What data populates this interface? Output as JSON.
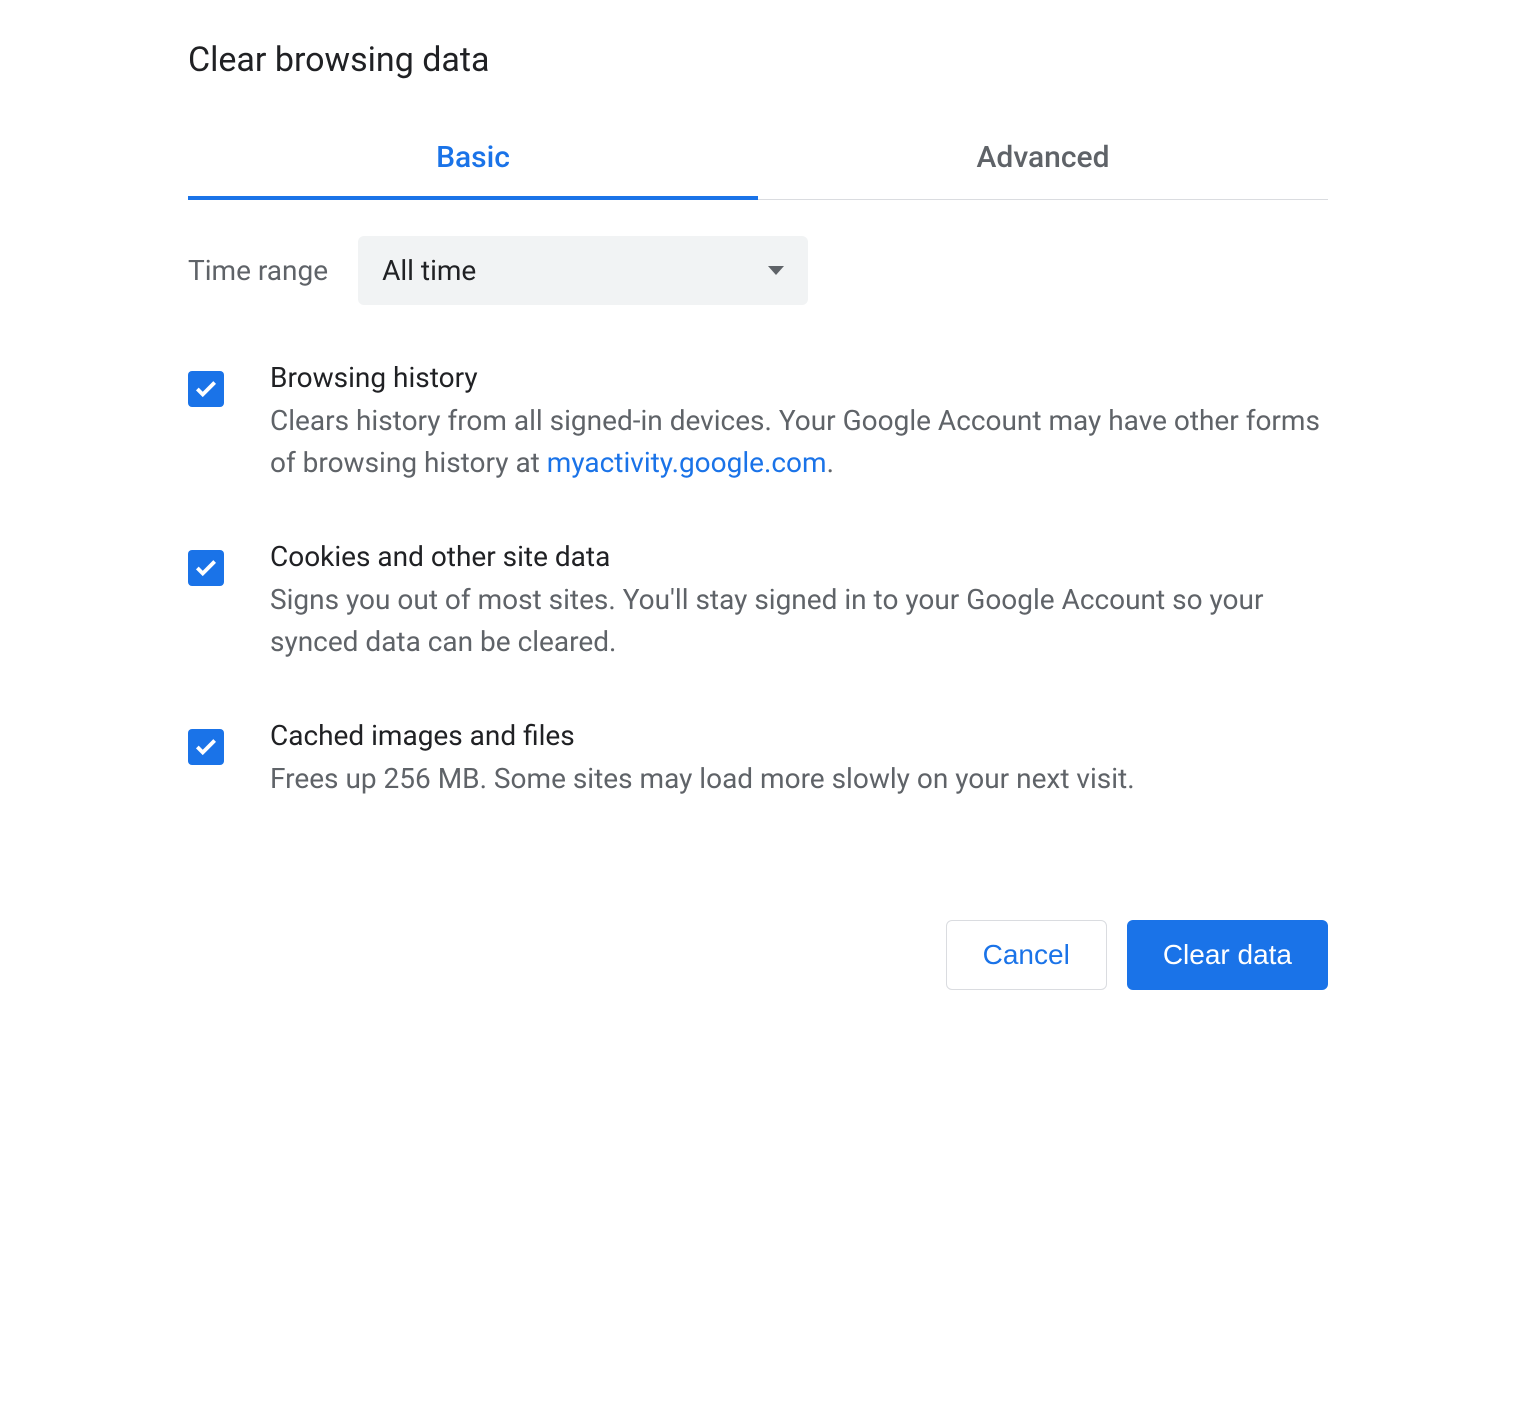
{
  "dialog": {
    "title": "Clear browsing data",
    "tabs": {
      "basic": "Basic",
      "advanced": "Advanced"
    },
    "timeRange": {
      "label": "Time range",
      "value": "All time"
    },
    "options": {
      "browsingHistory": {
        "title": "Browsing history",
        "desc_prefix": "Clears history from all signed-in devices. Your Google Account may have other forms of browsing history at ",
        "link_text": "myactivity.google.com",
        "desc_suffix": "."
      },
      "cookies": {
        "title": "Cookies and other site data",
        "desc": "Signs you out of most sites. You'll stay signed in to your Google Account so your synced data can be cleared."
      },
      "cache": {
        "title": "Cached images and files",
        "desc": "Frees up 256 MB. Some sites may load more slowly on your next visit."
      }
    },
    "buttons": {
      "cancel": "Cancel",
      "clear": "Clear data"
    }
  }
}
